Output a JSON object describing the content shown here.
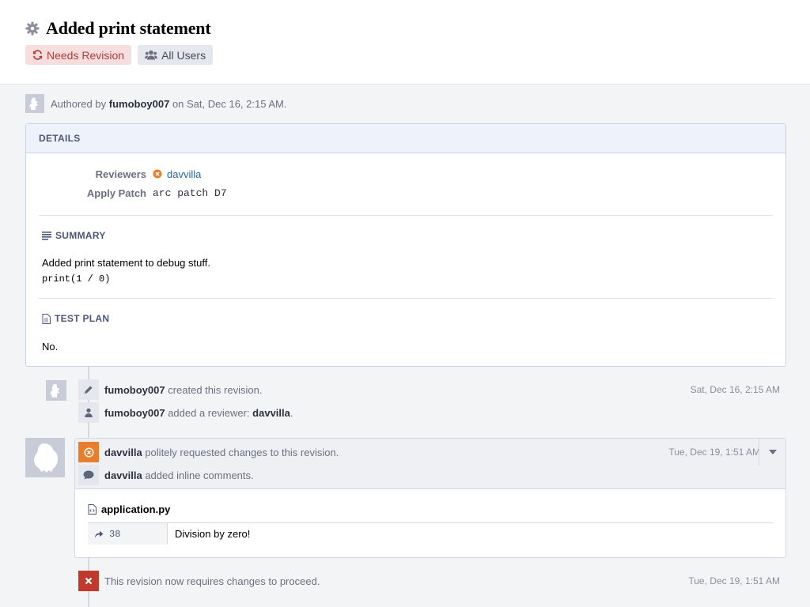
{
  "header": {
    "title": "Added print statement",
    "tags": [
      {
        "label": "Needs Revision",
        "icon": "refresh-icon"
      },
      {
        "label": "All Users",
        "icon": "users-icon"
      }
    ]
  },
  "author": {
    "prefix": "Authored by",
    "name": "fumoboy007",
    "suffix": "on Sat, Dec 16, 2:15 AM."
  },
  "details": {
    "heading": "DETAILS",
    "reviewers_label": "Reviewers",
    "reviewer_name": "davvilla",
    "apply_patch_label": "Apply Patch",
    "apply_patch_value": "arc patch D7",
    "summary_title": "SUMMARY",
    "summary_text": "Added print statement to debug stuff.",
    "summary_code": "print(1 / 0)",
    "test_plan_title": "TEST PLAN",
    "test_plan_text": "No."
  },
  "timeline": {
    "events": [
      {
        "actor": "fumoboy007",
        "action": "created this revision.",
        "date": "Sat, Dec 16, 2:15 AM",
        "icon": "pencil-icon"
      },
      {
        "actor": "fumoboy007",
        "action": "added a reviewer:",
        "target": "davvilla",
        "trailing": ".",
        "icon": "user-icon"
      }
    ],
    "comment": {
      "events": [
        {
          "actor": "davvilla",
          "action": "politely requested changes to this revision.",
          "date": "Tue, Dec 19, 1:51 AM",
          "icon": "x-circle-icon"
        },
        {
          "actor": "davvilla",
          "action": "added inline comments.",
          "icon": "speech-bubble-icon"
        }
      ],
      "file": "application.py",
      "line": "38",
      "inline_text": "Division by zero!"
    },
    "final_event": {
      "text": "This revision now requires changes to proceed.",
      "date": "Tue, Dec 19, 1:51 AM",
      "icon": "x-icon"
    }
  },
  "colors": {
    "accent_link": "#2765a6",
    "needs_revision_bg": "#f7dede",
    "needs_revision_text": "#b43a3a",
    "orange_icon": "#e87d2c",
    "red_icon": "#c0392b"
  }
}
